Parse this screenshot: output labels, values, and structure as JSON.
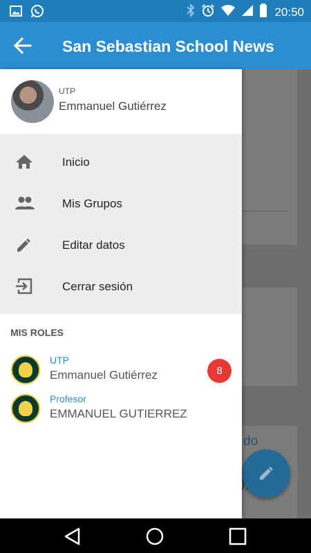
{
  "status_bar": {
    "time": "20:50",
    "left_icons": [
      "image-icon",
      "whatsapp-icon"
    ],
    "right_icons": [
      "bluetooth-icon",
      "alarm-icon",
      "wifi-icon",
      "signal-icon",
      "battery-icon"
    ]
  },
  "app_bar": {
    "title": "San Sebastian School News",
    "back_icon": "arrow-back-icon"
  },
  "drawer": {
    "profile": {
      "role": "UTP",
      "name": "Emmanuel Gutiérrez"
    },
    "menu": [
      {
        "label": "Inicio",
        "icon": "home-icon"
      },
      {
        "label": "Mis Grupos",
        "icon": "groups-icon"
      },
      {
        "label": "Editar datos",
        "icon": "edit-icon"
      },
      {
        "label": "Cerrar sesión",
        "icon": "logout-icon"
      }
    ],
    "roles_title": "MIS ROLES",
    "roles": [
      {
        "title": "UTP",
        "name": "Emmanuel Gutiérrez",
        "badge": "8"
      },
      {
        "title": "Profesor",
        "name": "EMMANUEL GUTIERREZ"
      }
    ]
  },
  "background": {
    "peek_text_1": "do",
    "peek_text_2": "),"
  },
  "fab": {
    "icon": "pencil-icon"
  },
  "nav_bar": {
    "icons": [
      "back-triangle-icon",
      "home-circle-icon",
      "recents-square-icon"
    ]
  },
  "colors": {
    "status_bar": "#1f7dba",
    "app_bar": "#2b8ed0",
    "badge": "#e53935",
    "role_title": "#2b8ed0"
  }
}
